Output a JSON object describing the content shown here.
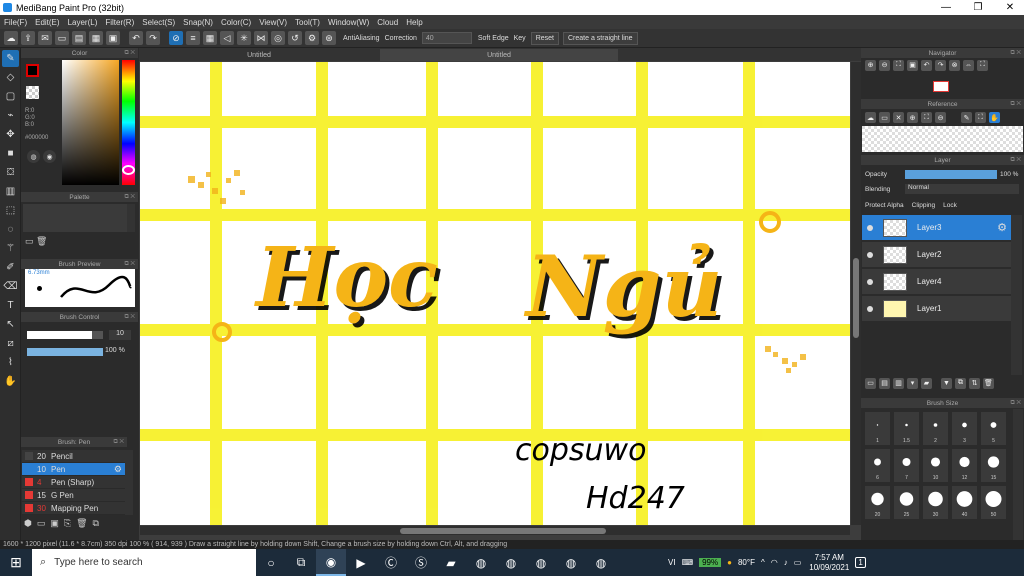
{
  "app": {
    "title": "MediBang Paint Pro (32bit)"
  },
  "menu": [
    "File(F)",
    "Edit(E)",
    "Layer(L)",
    "Filter(R)",
    "Select(S)",
    "Snap(N)",
    "Color(C)",
    "View(V)",
    "Tool(T)",
    "Window(W)",
    "Cloud",
    "Help"
  ],
  "toolbar": {
    "antialiasing": "AntiAliasing",
    "correction_label": "Correction",
    "correction_value": "40",
    "soft_edge": "Soft Edge",
    "key_label": "Key",
    "reset": "Reset",
    "straight_line": "Create a straight line"
  },
  "color_panel": {
    "title": "Color",
    "r": "R:0",
    "g": "G:0",
    "b": "B:0",
    "hex": "#000000"
  },
  "palette_panel": {
    "title": "Palette"
  },
  "brush_preview": {
    "title": "Brush Preview",
    "size": "6.73mm"
  },
  "brush_control": {
    "title": "Brush Control",
    "size_value": "10",
    "opacity_value": "100 %",
    "size_fill": 0.85,
    "opacity_fill": 1.0
  },
  "brush_list": {
    "title": "Brush: Pen",
    "items": [
      {
        "size": "20",
        "name": "Pencil",
        "color": "#444444"
      },
      {
        "size": "10",
        "name": "Pen",
        "color": "#2a7fd4"
      },
      {
        "size": "4",
        "name": "Pen (Sharp)",
        "color": "#e53935"
      },
      {
        "size": "15",
        "name": "G Pen",
        "color": "#e53935"
      },
      {
        "size": "30",
        "name": "Mapping Pen",
        "color": "#e53935"
      }
    ]
  },
  "tabs": [
    "Untitled",
    "Untitled"
  ],
  "canvas_art": {
    "title_text_1": "Học",
    "title_text_2": "Ngủ",
    "signature_1": "copsuwo",
    "signature_2": "Hd247"
  },
  "navigator": {
    "title": "Navigator"
  },
  "reference": {
    "title": "Reference"
  },
  "layer_panel": {
    "title": "Layer",
    "opacity_label": "Opacity",
    "opacity_value": "100 %",
    "blending_label": "Blending",
    "blending_value": "Normal",
    "protect_alpha": "Protect Alpha",
    "clipping": "Clipping",
    "lock": "Lock",
    "layers": [
      "Layer3",
      "Layer2",
      "Layer4",
      "Layer1"
    ]
  },
  "brush_size": {
    "title": "Brush Size",
    "labels": [
      "1",
      "1.5",
      "2",
      "3",
      "5",
      "6",
      "7",
      "10",
      "12",
      "15",
      "20",
      "25",
      "30",
      "40",
      "50"
    ]
  },
  "status": {
    "text": "1600 * 1200 pixel   (11.6 * 8.7cm)   350 dpi   100 %   ( 914, 939 )   Draw a straight line by holding down Shift, Change a brush size by holding down Ctrl, Alt, and dragging"
  },
  "taskbar": {
    "search_placeholder": "Type here to search",
    "battery": "99%",
    "weather": "80°F",
    "time": "7:57 AM",
    "date": "10/09/2021",
    "lang": "VI",
    "notifications": "1"
  }
}
